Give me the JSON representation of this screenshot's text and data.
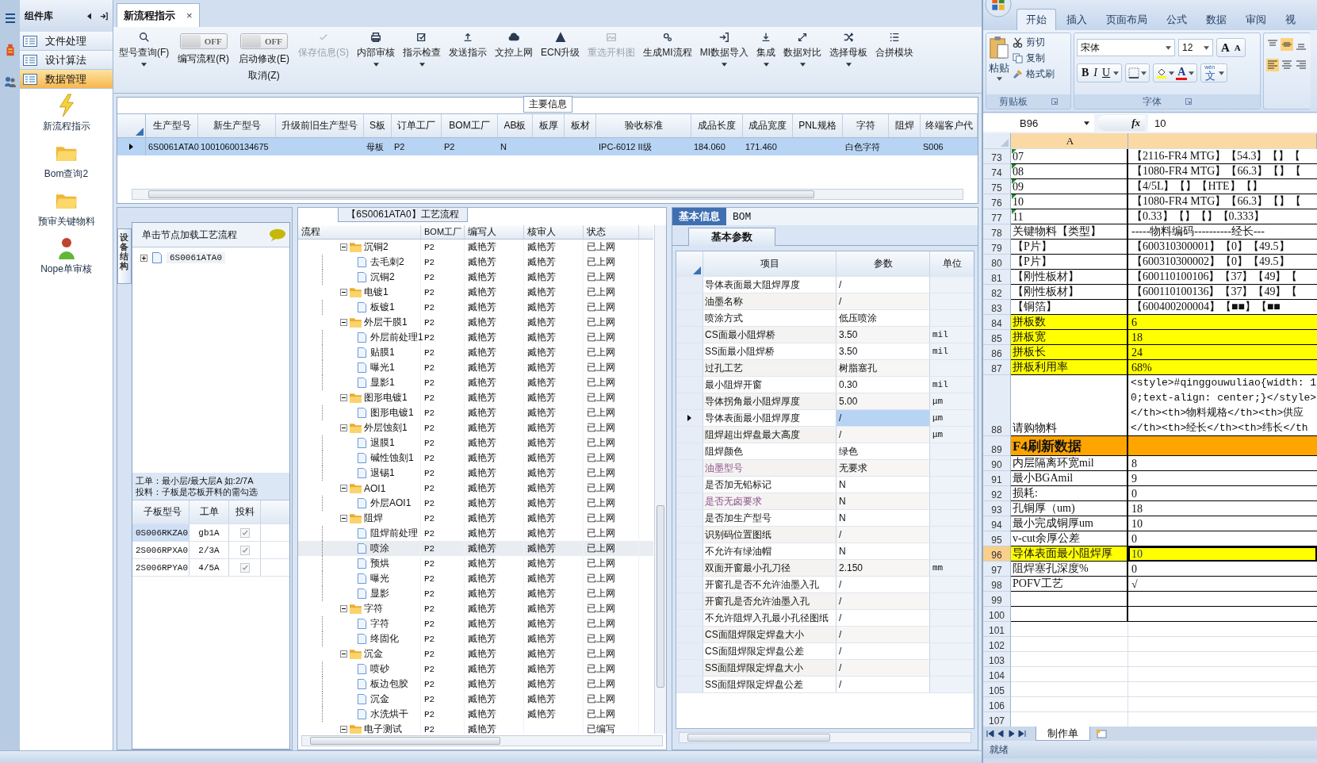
{
  "sidebar": {
    "title": "组件库",
    "items": [
      {
        "label": "文件处理",
        "selected": false
      },
      {
        "label": "设计算法",
        "selected": false
      },
      {
        "label": "数据管理",
        "selected": true
      }
    ],
    "tools": [
      {
        "label": "新流程指示"
      },
      {
        "label": "Bom查询2"
      },
      {
        "label": "预审关键物料"
      },
      {
        "label": "Nope单审核"
      }
    ]
  },
  "tabs": [
    {
      "label": "新流程指示",
      "close": "×",
      "selected": true
    }
  ],
  "toolbar": [
    {
      "kind": "button",
      "label": "型号查询(F)",
      "disabled": false,
      "dropdown": true
    },
    {
      "kind": "toggle",
      "label": "编写流程(R)",
      "switch_text": "OFF",
      "on": false
    },
    {
      "kind": "toggle",
      "label": "启动修改(E)",
      "sublabel": "取消(Z)",
      "switch_text": "OFF",
      "on": false
    },
    {
      "kind": "button",
      "label": "保存信息(S)",
      "disabled": true,
      "dropdown": false
    },
    {
      "kind": "button",
      "label": "内部审核",
      "disabled": false,
      "dropdown": true
    },
    {
      "kind": "button",
      "label": "指示检查",
      "disabled": false,
      "dropdown": true
    },
    {
      "kind": "button",
      "label": "发送指示",
      "disabled": false,
      "dropdown": false
    },
    {
      "kind": "button",
      "label": "文控上网",
      "disabled": false,
      "dropdown": false
    },
    {
      "kind": "button",
      "label": "ECN升级",
      "disabled": false,
      "dropdown": false
    },
    {
      "kind": "button",
      "label": "重选开料图",
      "disabled": true,
      "dropdown": false
    },
    {
      "kind": "button",
      "label": "生成MI流程",
      "disabled": false,
      "dropdown": false
    },
    {
      "kind": "button",
      "label": "MI数据导入",
      "disabled": false,
      "dropdown": true
    },
    {
      "kind": "button",
      "label": "集成",
      "disabled": false,
      "dropdown": true
    },
    {
      "kind": "button",
      "label": "数据对比",
      "disabled": false,
      "dropdown": true
    },
    {
      "kind": "button",
      "label": "选择母板",
      "disabled": false,
      "dropdown": true
    },
    {
      "kind": "button",
      "label": "合拼模块",
      "disabled": false,
      "dropdown": false
    }
  ],
  "main_info": {
    "title": "主要信息",
    "columns": [
      "生产型号",
      "新生产型号",
      "升级前旧生产型号",
      "S板",
      "订单工厂",
      "BOM工厂",
      "AB板",
      "板厚",
      "板材",
      "验收标准",
      "成品长度",
      "成品宽度",
      "PNL规格",
      "字符",
      "阻焊",
      "终端客户代"
    ],
    "rows": [
      {
        "selected": true,
        "cells": [
          "6S0061ATA0",
          "10010600134675",
          null,
          "母板",
          "P2",
          "P2",
          "N",
          null,
          null,
          "IPC-6012 II级",
          "184.060",
          "171.460",
          null,
          "白色字符",
          null,
          "S006"
        ]
      }
    ]
  },
  "structure": {
    "vertical_tab": "设备结构",
    "title": "单击节点加载工艺流程",
    "tree": [
      {
        "label": "6S0061ATA0",
        "expanded": false
      }
    ],
    "notes": [
      "工单：最小层/最大层A 如:2/7A",
      "投料：子板是芯板开料的需勾选"
    ],
    "columns": [
      "子板型号",
      "工单",
      "投料"
    ],
    "rows": [
      {
        "model": "0S006RKZA0",
        "order": "gb1A",
        "feed": true,
        "selected": true
      },
      {
        "model": "2S006RPXA0",
        "order": "2/3A",
        "feed": true,
        "selected": false
      },
      {
        "model": "2S006RPYA0",
        "order": "4/5A",
        "feed": true,
        "selected": false
      }
    ]
  },
  "process": {
    "title": "【6S0061ATA0】工艺流程",
    "columns": [
      "流程",
      "BOM工厂",
      "编写人",
      "核审人",
      "状态"
    ],
    "rows": [
      {
        "label": "沉铜2",
        "bom": "P2",
        "writer": "臧艳芳",
        "reviewer": "臧艳芳",
        "status": "已上网",
        "expanded": true,
        "selected": false,
        "children": [
          {
            "label": "去毛刺2",
            "bom": "P2",
            "writer": "臧艳芳",
            "reviewer": "臧艳芳",
            "status": "已上网",
            "selected": false
          },
          {
            "label": "沉铜2",
            "bom": "P2",
            "writer": "臧艳芳",
            "reviewer": "臧艳芳",
            "status": "已上网",
            "selected": false
          }
        ]
      },
      {
        "label": "电镀1",
        "bom": "P2",
        "writer": "臧艳芳",
        "reviewer": "臧艳芳",
        "status": "已上网",
        "expanded": true,
        "selected": false,
        "children": [
          {
            "label": "板镀1",
            "bom": "P2",
            "writer": "臧艳芳",
            "reviewer": "臧艳芳",
            "status": "已上网",
            "selected": false
          }
        ]
      },
      {
        "label": "外层干膜1",
        "bom": "P2",
        "writer": "臧艳芳",
        "reviewer": "臧艳芳",
        "status": "已上网",
        "expanded": true,
        "selected": false,
        "children": [
          {
            "label": "外层前处理1",
            "bom": "P2",
            "writer": "臧艳芳",
            "reviewer": "臧艳芳",
            "status": "已上网",
            "selected": false
          },
          {
            "label": "贴膜1",
            "bom": "P2",
            "writer": "臧艳芳",
            "reviewer": "臧艳芳",
            "status": "已上网",
            "selected": false
          },
          {
            "label": "曝光1",
            "bom": "P2",
            "writer": "臧艳芳",
            "reviewer": "臧艳芳",
            "status": "已上网",
            "selected": false
          },
          {
            "label": "显影1",
            "bom": "P2",
            "writer": "臧艳芳",
            "reviewer": "臧艳芳",
            "status": "已上网",
            "selected": false
          }
        ]
      },
      {
        "label": "图形电镀1",
        "bom": "P2",
        "writer": "臧艳芳",
        "reviewer": "臧艳芳",
        "status": "已上网",
        "expanded": true,
        "selected": false,
        "children": [
          {
            "label": "图形电镀1",
            "bom": "P2",
            "writer": "臧艳芳",
            "reviewer": "臧艳芳",
            "status": "已上网",
            "selected": false
          }
        ]
      },
      {
        "label": "外层蚀刻1",
        "bom": "P2",
        "writer": "臧艳芳",
        "reviewer": "臧艳芳",
        "status": "已上网",
        "expanded": true,
        "selected": false,
        "children": [
          {
            "label": "退膜1",
            "bom": "P2",
            "writer": "臧艳芳",
            "reviewer": "臧艳芳",
            "status": "已上网",
            "selected": false
          },
          {
            "label": "碱性蚀刻1",
            "bom": "P2",
            "writer": "臧艳芳",
            "reviewer": "臧艳芳",
            "status": "已上网",
            "selected": false
          },
          {
            "label": "退锡1",
            "bom": "P2",
            "writer": "臧艳芳",
            "reviewer": "臧艳芳",
            "status": "已上网",
            "selected": false
          }
        ]
      },
      {
        "label": "AOI1",
        "bom": "P2",
        "writer": "臧艳芳",
        "reviewer": "臧艳芳",
        "status": "已上网",
        "expanded": true,
        "selected": false,
        "children": [
          {
            "label": "外层AOI1",
            "bom": "P2",
            "writer": "臧艳芳",
            "reviewer": "臧艳芳",
            "status": "已上网",
            "selected": false
          }
        ]
      },
      {
        "label": "阻焊",
        "bom": "P2",
        "writer": "臧艳芳",
        "reviewer": "臧艳芳",
        "status": "已上网",
        "expanded": true,
        "selected": false,
        "children": [
          {
            "label": "阻焊前处理",
            "bom": "P2",
            "writer": "臧艳芳",
            "reviewer": "臧艳芳",
            "status": "已上网",
            "selected": false
          },
          {
            "label": "喷涂",
            "bom": "P2",
            "writer": "臧艳芳",
            "reviewer": "臧艳芳",
            "status": "已上网",
            "selected": true
          },
          {
            "label": "预烘",
            "bom": "P2",
            "writer": "臧艳芳",
            "reviewer": "臧艳芳",
            "status": "已上网",
            "selected": false
          },
          {
            "label": "曝光",
            "bom": "P2",
            "writer": "臧艳芳",
            "reviewer": "臧艳芳",
            "status": "已上网",
            "selected": false
          },
          {
            "label": "显影",
            "bom": "P2",
            "writer": "臧艳芳",
            "reviewer": "臧艳芳",
            "status": "已上网",
            "selected": false
          }
        ]
      },
      {
        "label": "字符",
        "bom": "P2",
        "writer": "臧艳芳",
        "reviewer": "臧艳芳",
        "status": "已上网",
        "expanded": true,
        "selected": false,
        "children": [
          {
            "label": "字符",
            "bom": "P2",
            "writer": "臧艳芳",
            "reviewer": "臧艳芳",
            "status": "已上网",
            "selected": false
          },
          {
            "label": "终固化",
            "bom": "P2",
            "writer": "臧艳芳",
            "reviewer": "臧艳芳",
            "status": "已上网",
            "selected": false
          }
        ]
      },
      {
        "label": "沉金",
        "bom": "P2",
        "writer": "臧艳芳",
        "reviewer": "臧艳芳",
        "status": "已上网",
        "expanded": true,
        "selected": false,
        "children": [
          {
            "label": "喷砂",
            "bom": "P2",
            "writer": "臧艳芳",
            "reviewer": "臧艳芳",
            "status": "已上网",
            "selected": false
          },
          {
            "label": "板边包胶",
            "bom": "P2",
            "writer": "臧艳芳",
            "reviewer": "臧艳芳",
            "status": "已上网",
            "selected": false
          },
          {
            "label": "沉金",
            "bom": "P2",
            "writer": "臧艳芳",
            "reviewer": "臧艳芳",
            "status": "已上网",
            "selected": false
          },
          {
            "label": "水洗烘干",
            "bom": "P2",
            "writer": "臧艳芳",
            "reviewer": "臧艳芳",
            "status": "已上网",
            "selected": false
          }
        ]
      },
      {
        "label": "电子测试",
        "bom": "P2",
        "writer": "臧艳芳",
        "status": "已编写",
        "expanded": true,
        "selected": false
      }
    ]
  },
  "details": {
    "tabs": [
      {
        "label": "基本信息",
        "selected": true
      },
      {
        "label": "BOM",
        "selected": false
      }
    ],
    "subtab": "基本参数",
    "columns": [
      "项目",
      "参数",
      "单位"
    ],
    "rows": [
      {
        "item": "导体表面最大阻焊厚度",
        "value": "/",
        "flagged": false,
        "selected": false
      },
      {
        "item": "油墨名称",
        "value": "/",
        "flagged": false,
        "selected": false
      },
      {
        "item": "喷涂方式",
        "value": "低压喷涂",
        "flagged": false,
        "selected": false
      },
      {
        "item": "CS面最小阻焊桥",
        "value": "3.50",
        "unit": "mil",
        "flagged": false,
        "selected": false
      },
      {
        "item": "SS面最小阻焊桥",
        "value": "3.50",
        "unit": "mil",
        "flagged": false,
        "selected": false
      },
      {
        "item": "过孔工艺",
        "value": "树脂塞孔",
        "flagged": false,
        "selected": false
      },
      {
        "item": "最小阻焊开窗",
        "value": "0.30",
        "unit": "mil",
        "flagged": false,
        "selected": false
      },
      {
        "item": "导体拐角最小阻焊厚度",
        "value": "5.00",
        "unit": "μm",
        "flagged": false,
        "selected": false
      },
      {
        "item": "导体表面最小阻焊厚度",
        "value": "/",
        "unit": "μm",
        "flagged": false,
        "selected": true
      },
      {
        "item": "阻焊超出焊盘最大高度",
        "value": "/",
        "unit": "μm",
        "flagged": false,
        "selected": false
      },
      {
        "item": "阻焊颜色",
        "value": "绿色",
        "flagged": false,
        "selected": false
      },
      {
        "item": "油墨型号",
        "value": "无要求",
        "flagged": true,
        "selected": false
      },
      {
        "item": "是否加无铅标记",
        "value": "N",
        "flagged": false,
        "selected": false
      },
      {
        "item": "是否无卤要求",
        "value": "N",
        "flagged": true,
        "selected": false
      },
      {
        "item": "是否加生产型号",
        "value": "N",
        "flagged": false,
        "selected": false
      },
      {
        "item": "识别码位置图纸",
        "value": "/",
        "flagged": false,
        "selected": false
      },
      {
        "item": "不允许有绿油帽",
        "value": "N",
        "flagged": false,
        "selected": false
      },
      {
        "item": "双面开窗最小孔刀径",
        "value": "2.150",
        "unit": "mm",
        "flagged": false,
        "selected": false
      },
      {
        "item": "开窗孔是否不允许油墨入孔",
        "value": "/",
        "flagged": false,
        "selected": false
      },
      {
        "item": "开窗孔是否允许油墨入孔",
        "value": "/",
        "flagged": false,
        "selected": false
      },
      {
        "item": "不允许阻焊入孔最小孔径图纸",
        "value": "/",
        "flagged": false,
        "selected": false
      },
      {
        "item": "CS面阻焊限定焊盘大小",
        "value": "/",
        "flagged": false,
        "selected": false
      },
      {
        "item": "CS面阻焊限定焊盘公差",
        "value": "/",
        "flagged": false,
        "selected": false
      },
      {
        "item": "SS面阻焊限定焊盘大小",
        "value": "/",
        "flagged": false,
        "selected": false
      },
      {
        "item": "SS面阻焊限定焊盘公差",
        "value": "/",
        "flagged": false,
        "selected": false
      }
    ]
  },
  "excel": {
    "ribbon_tabs": [
      {
        "label": "开始",
        "selected": true
      },
      {
        "label": "插入",
        "selected": false
      },
      {
        "label": "页面布局",
        "selected": false
      },
      {
        "label": "公式",
        "selected": false
      },
      {
        "label": "数据",
        "selected": false
      },
      {
        "label": "审阅",
        "selected": false
      },
      {
        "label": "视",
        "selected": false
      }
    ],
    "clipboard": {
      "paste": "粘贴",
      "actions": [
        "剪切",
        "复制",
        "格式刷"
      ],
      "group_label": "剪贴板"
    },
    "font": {
      "name": "宋体",
      "size": "12",
      "grow": "A",
      "shrink": "A",
      "styles": [
        "B",
        "I",
        "U"
      ],
      "color_glyph": "A",
      "phonetic": "文",
      "phonetic_ruby": "wén",
      "group_label": "字体"
    },
    "name_box": "B96",
    "fx": "fx",
    "formula": "10",
    "column": "A",
    "rows": [
      {
        "num": "73",
        "a": "07",
        "b": "【2116-FR4 MTG】【54.3】【】【",
        "text_flag": true,
        "bordered": true,
        "selected": false
      },
      {
        "num": "74",
        "a": "08",
        "b": "【1080-FR4 MTG】【66.3】【】【",
        "text_flag": true,
        "bordered": true,
        "selected": false
      },
      {
        "num": "75",
        "a": "09",
        "b": "【4/5L】【】【HTE】【】",
        "text_flag": true,
        "bordered": true,
        "selected": false
      },
      {
        "num": "76",
        "a": "10",
        "b": "【1080-FR4 MTG】【66.3】【】【",
        "text_flag": true,
        "bordered": true,
        "selected": false
      },
      {
        "num": "77",
        "a": "11",
        "b": "【0.33】【】【】【0.333】",
        "text_flag": true,
        "bordered": true,
        "selected": false
      },
      {
        "num": "78",
        "a": "关键物料【类型】",
        "b": "-----物料编码----------经长---",
        "text_flag": false,
        "bordered": true,
        "selected": false
      },
      {
        "num": "79",
        "a": "【P片】",
        "b": "【600310300001】【0】【49.5】",
        "text_flag": false,
        "bordered": true,
        "selected": false
      },
      {
        "num": "80",
        "a": "【P片】",
        "b": "【600310300002】【0】【49.5】",
        "text_flag": false,
        "bordered": true,
        "selected": false
      },
      {
        "num": "81",
        "a": "【刚性板材】",
        "b": "【600110100106】【37】【49】【",
        "text_flag": false,
        "bordered": true,
        "selected": false
      },
      {
        "num": "82",
        "a": "【刚性板材】",
        "b": "【600110100136】【37】【49】【",
        "text_flag": false,
        "bordered": true,
        "selected": false
      },
      {
        "num": "83",
        "a": "【铜箔】",
        "b": "【600400200004】【■■】【■■",
        "text_flag": false,
        "bordered": true,
        "selected": false
      },
      {
        "num": "84",
        "a": "拼板数",
        "b": "6",
        "color": "#ffff00",
        "text_flag": false,
        "bordered": true,
        "selected": false
      },
      {
        "num": "85",
        "a": "拼板宽",
        "b": "18",
        "color": "#ffff00",
        "text_flag": false,
        "bordered": true,
        "selected": false
      },
      {
        "num": "86",
        "a": "拼板长",
        "b": "24",
        "color": "#ffff00",
        "text_flag": false,
        "bordered": true,
        "selected": false
      },
      {
        "num": "87",
        "a": "拼板利用率",
        "b": "68%",
        "color": "#ffff00",
        "text_flag": false,
        "bordered": true,
        "selected": false
      },
      {
        "num": "88",
        "a": "请购物料",
        "b_lines": [
          "<style>#qinggouwuliao{width: 1",
          "0;text-align: center;}</style>",
          "</th><th>物料规格</th><th>供应",
          "</th><th>经长</th><th>纬长</th"
        ],
        "text_flag": false,
        "bordered": true,
        "selected": false
      },
      {
        "num": "89",
        "a": "F4刷新数据",
        "color": "#ffa500",
        "bold": true,
        "text_flag": false,
        "bordered": true,
        "selected": false
      },
      {
        "num": "90",
        "a": "内层隔离环宽mil",
        "b": "8",
        "text_flag": false,
        "bordered": true,
        "selected": false
      },
      {
        "num": "91",
        "a": "最小BGAmil",
        "b": "9",
        "text_flag": false,
        "bordered": true,
        "selected": false
      },
      {
        "num": "92",
        "a": "损耗:",
        "b": "0",
        "text_flag": false,
        "bordered": true,
        "selected": false
      },
      {
        "num": "93",
        "a": "孔铜厚（um)",
        "b": "18",
        "text_flag": false,
        "bordered": true,
        "selected": false
      },
      {
        "num": "94",
        "a": "最小完成铜厚um",
        "b": "10",
        "text_flag": false,
        "bordered": true,
        "selected": false
      },
      {
        "num": "95",
        "a": "v-cut余厚公差",
        "b": "0",
        "text_flag": false,
        "bordered": true,
        "selected": false
      },
      {
        "num": "96",
        "a": "导体表面最小阻焊厚",
        "b": "10",
        "color": "#ffff00",
        "text_flag": false,
        "bordered": true,
        "selected": true
      },
      {
        "num": "97",
        "a": "阻焊塞孔深度%",
        "b": "0",
        "text_flag": false,
        "bordered": true,
        "selected": false
      },
      {
        "num": "98",
        "a": "POFV工艺",
        "b": "√",
        "text_flag": false,
        "bordered": true,
        "selected": false
      },
      {
        "num": "99",
        "text_flag": false,
        "bordered": true,
        "selected": false
      },
      {
        "num": "100",
        "text_flag": false,
        "bordered": true,
        "selected": false
      },
      {
        "num": "101",
        "text_flag": false,
        "bordered": false,
        "selected": false
      },
      {
        "num": "102",
        "text_flag": false,
        "bordered": false,
        "selected": false
      },
      {
        "num": "103",
        "text_flag": false,
        "bordered": false,
        "selected": false
      },
      {
        "num": "104",
        "text_flag": false,
        "bordered": false,
        "selected": false
      },
      {
        "num": "105",
        "text_flag": false,
        "bordered": false,
        "selected": false
      },
      {
        "num": "106",
        "text_flag": false,
        "bordered": false,
        "selected": false
      },
      {
        "num": "107",
        "text_flag": false,
        "bordered": false,
        "selected": false
      }
    ],
    "sheet_tabs": [
      {
        "label": "制作单",
        "selected": true
      }
    ],
    "status": "就绪"
  }
}
